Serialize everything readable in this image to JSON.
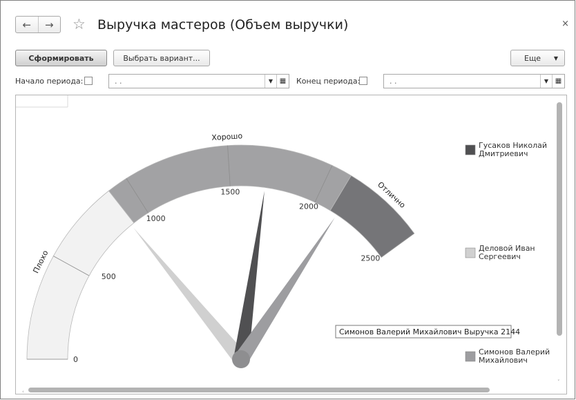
{
  "window": {
    "title": "Выручка мастеров (Объем выручки)",
    "close_glyph": "×",
    "back_glyph": "←",
    "forward_glyph": "→",
    "star_glyph": "☆"
  },
  "toolbar": {
    "generate_label": "Сформировать",
    "variant_label": "Выбрать вариант...",
    "more_label": "Еще",
    "more_arrow": "▼"
  },
  "filters": {
    "start_label": "Начало периода:",
    "start_value": ".  .",
    "end_label": "Конец периода:",
    "end_value": ".  .",
    "dropdown_glyph": "▼",
    "calendar_glyph": "▦"
  },
  "chart_data": {
    "type": "gauge",
    "min": 0,
    "max": 2500,
    "ticks": [
      0,
      500,
      1000,
      1500,
      2000,
      2500
    ],
    "tick_labels": [
      "0",
      "500",
      "1000",
      "1500",
      "2000",
      "2500"
    ],
    "bands": [
      {
        "label": "Плохо",
        "from": 0,
        "to": 900,
        "color": "#f2f2f2"
      },
      {
        "label": "Хорошо",
        "from": 900,
        "to": 2100,
        "color": "#a2a2a4"
      },
      {
        "label": "Отлично",
        "from": 2100,
        "to": 2500,
        "color": "#757578"
      }
    ],
    "series": [
      {
        "name": "Гусаков Николай Дмитриевич",
        "name_lines": [
          "Гусаков Николай",
          "Дмитриевич"
        ],
        "value": 1700,
        "color": "#505052"
      },
      {
        "name": "Деловой Иван Сергеевич",
        "name_lines": [
          "Деловой Иван",
          "Сергеевич"
        ],
        "value": 880,
        "color": "#d0d0d0"
      },
      {
        "name": "Симонов Валерий Михайлович",
        "name_lines": [
          "Симонов Валерий",
          "Михайлович"
        ],
        "value": 2144,
        "color": "#9d9da0"
      }
    ],
    "tooltip": "Симонов Валерий Михайлович Выручка 2144",
    "legend_position": "right"
  }
}
